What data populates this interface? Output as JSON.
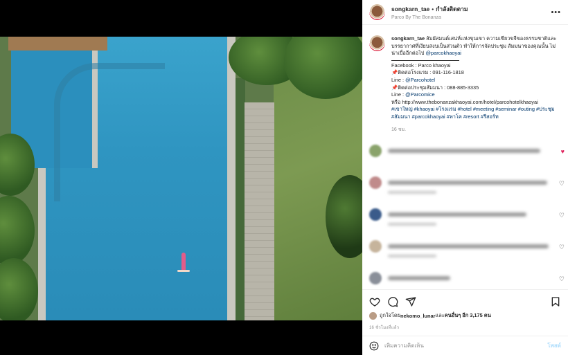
{
  "header": {
    "username": "songkarn_tae",
    "separator": "•",
    "following_label": "กำลังติดตาม",
    "location": "Parco By The Bonanza",
    "more_icon": "more-horizontal-icon"
  },
  "caption": {
    "username": "songkarn_tae",
    "text": "สัมผัสมนต์เสน่ห์แห่งขุนเขา ความเขียวขจีของธรรมชาติและบรรยากาศที่เงียบสงบเป็นส่วนตัว ทำให้การจัดประชุม สัมมนาของคุณนั้น ไม่น่าเบื่ออีกต่อไป",
    "mention": "@parcokhaoyai",
    "facebook_line": "Facebook : Parco khaoyai",
    "hotel_contact": "ติดต่อโรงแรม : 091-116-1818",
    "line1_label": "Line : ",
    "line1_handle": "@Parcohotel",
    "meeting_contact": "ติดต่อประชุมสัมมนา : 088-885-3335",
    "line2_label": "Line : ",
    "line2_handle": "@Parcomice",
    "or_label": "หรือ ",
    "url": "http://www.thebonanzakhaoyai.com/hotel/parcohotelkhaoyai",
    "hashtags": "#เขาใหญ่ #khaoyai #โรงแรม #hotel #meeting #seminar #outing #ประชุม #สัมมนา #parcokhaoyai #พาโค #resort #รีสอร์ท",
    "time": "16 ชม."
  },
  "comments": [
    {
      "avatar_color": "#8aa36b"
    },
    {
      "avatar_color": "#c08a8a"
    },
    {
      "avatar_color": "#3a5b8a"
    },
    {
      "avatar_color": "#c6b49c"
    },
    {
      "avatar_color": "#8a8f99"
    }
  ],
  "actions": {
    "like_icon": "heart-icon",
    "comment_icon": "comment-icon",
    "share_icon": "paper-plane-icon",
    "save_icon": "bookmark-icon"
  },
  "likes": {
    "prefix": "ถูกใจโดย ",
    "first_user": "nekomo_lunar",
    "middle": " และ ",
    "others": "คนอื่นๆ อีก 3,175 คน"
  },
  "date": "16 ชั่วโมงที่แล้ว",
  "add_comment": {
    "placeholder": "เพิ่มความคิดเห็น",
    "post_label": "โพสต์",
    "emoji_icon": "smiley-icon"
  },
  "colors": {
    "link": "#00376b",
    "pool": "#2f95c1",
    "post_disabled": "#b2dffc"
  }
}
